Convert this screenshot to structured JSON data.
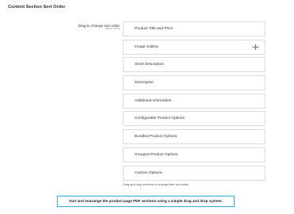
{
  "section": {
    "title": "Content Section Sort Order"
  },
  "field": {
    "label": "Drag to change sort order",
    "scope": "[store view]",
    "help": "Drag and drop sections to change their sort order."
  },
  "items": [
    {
      "label": "Product Title and Price"
    },
    {
      "label": "Image Gallery",
      "icon": "move-icon"
    },
    {
      "label": "Short Description"
    },
    {
      "label": "Description"
    },
    {
      "label": "Additional Information"
    },
    {
      "label": "Configurable Product Options"
    },
    {
      "label": "Bundled Product Options"
    },
    {
      "label": "Grouped Product Options"
    },
    {
      "label": "Custom Options"
    }
  ],
  "callout": {
    "text": "Sort and rearrange the product page PDF sections using a simple drag and drop system."
  },
  "colors": {
    "callout_border": "#47b0d8"
  }
}
